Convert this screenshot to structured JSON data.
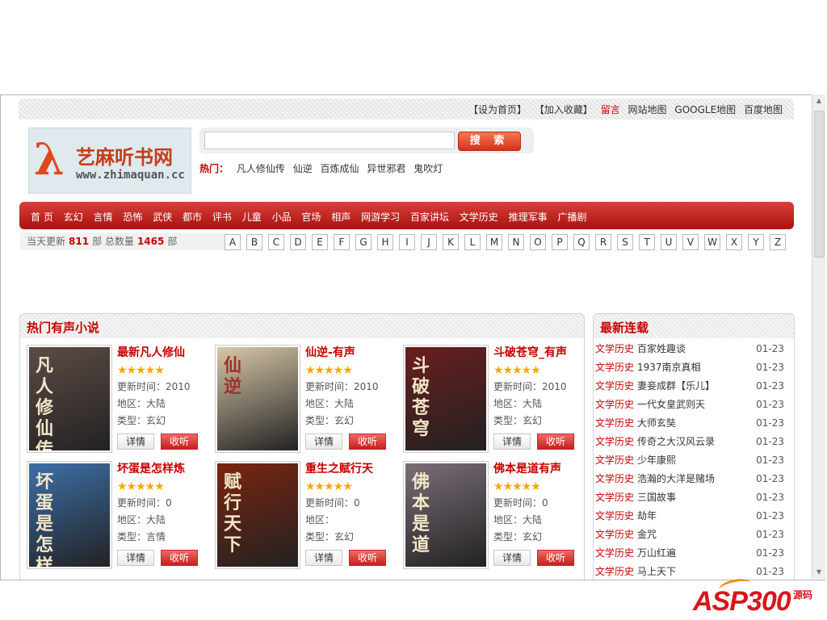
{
  "toplinks": [
    "【设为首页】",
    "【加入收藏】",
    "留言",
    "网站地图",
    "GOOGLE地图",
    "百度地图"
  ],
  "logo": {
    "name": "艺麻听书网",
    "url": "www.zhimaquan.cc"
  },
  "search": {
    "value": "",
    "button": "搜 索"
  },
  "hot": {
    "label": "热门：",
    "keywords": [
      "凡人修仙传",
      "仙逆",
      "百炼成仙",
      "异世邪君",
      "鬼吹灯"
    ]
  },
  "nav": [
    "首 页",
    "玄幻",
    "言情",
    "恐怖",
    "武侠",
    "都市",
    "评书",
    "儿童",
    "小品",
    "官场",
    "相声",
    "网游学习",
    "百家讲坛",
    "文学历史",
    "推理军事",
    "广播剧"
  ],
  "stats": {
    "today_label": "当天更新",
    "today": "811",
    "unit": "部",
    "total_label": "总数量",
    "total": "1465"
  },
  "letters": [
    "A",
    "B",
    "C",
    "D",
    "E",
    "F",
    "G",
    "H",
    "I",
    "J",
    "K",
    "L",
    "M",
    "N",
    "O",
    "P",
    "Q",
    "R",
    "S",
    "T",
    "U",
    "V",
    "W",
    "X",
    "Y",
    "Z"
  ],
  "main": {
    "title": "热门有声小说",
    "books": [
      {
        "title": "最新凡人修仙",
        "stars": "★★★★★",
        "update": "更新时间：2010",
        "region": "地区：大陆",
        "type": "类型：玄幻",
        "cover_text": "凡人修仙传",
        "cover_color": "#5d4b45"
      },
      {
        "title": "仙逆-有声",
        "stars": "★★★★★",
        "update": "更新时间：2010",
        "region": "地区：大陆",
        "type": "类型：玄幻",
        "cover_text": "仙逆",
        "cover_color": "#d8c7a8"
      },
      {
        "title": "斗破苍穹_有声",
        "stars": "★★★★★",
        "update": "更新时间：2010",
        "region": "地区：大陆",
        "type": "类型：玄幻",
        "cover_text": "斗破苍穹",
        "cover_color": "#6a1e1e"
      },
      {
        "title": "坏蛋是怎样炼",
        "stars": "★★★★★",
        "update": "更新时间：0",
        "region": "地区：大陆",
        "type": "类型：言情",
        "cover_text": "坏蛋是怎样炼成",
        "cover_color": "#3d6fa8"
      },
      {
        "title": "重生之赋行天",
        "stars": "★★★★★",
        "update": "更新时间：0",
        "region": "地区：",
        "type": "类型：玄幻",
        "cover_text": "赋行天下",
        "cover_color": "#7a2410"
      },
      {
        "title": "佛本是道有声",
        "stars": "★★★★★",
        "update": "更新时间：0",
        "region": "地区：大陆",
        "type": "类型：玄幻",
        "cover_text": "佛本是道",
        "cover_color": "#7a6e78"
      }
    ],
    "btn_detail": "详情",
    "btn_listen": "收听"
  },
  "side": {
    "title": "最新连载",
    "items": [
      {
        "cat": "文学历史",
        "name": "百家姓趣谈",
        "date": "01-23"
      },
      {
        "cat": "文学历史",
        "name": "1937南京真相",
        "date": "01-23"
      },
      {
        "cat": "文学历史",
        "name": "妻妾成群【乐儿】",
        "date": "01-23"
      },
      {
        "cat": "文学历史",
        "name": "一代女皇武则天",
        "date": "01-23"
      },
      {
        "cat": "文学历史",
        "name": "大师玄奘",
        "date": "01-23"
      },
      {
        "cat": "文学历史",
        "name": "传奇之大汉风云录",
        "date": "01-23"
      },
      {
        "cat": "文学历史",
        "name": "少年康熙",
        "date": "01-23"
      },
      {
        "cat": "文学历史",
        "name": "浩瀚的大洋是赌场",
        "date": "01-23"
      },
      {
        "cat": "文学历史",
        "name": "三国故事",
        "date": "01-23"
      },
      {
        "cat": "文学历史",
        "name": "劫年",
        "date": "01-23"
      },
      {
        "cat": "文学历史",
        "name": "金咒",
        "date": "01-23"
      },
      {
        "cat": "文学历史",
        "name": "万山红遍",
        "date": "01-23"
      },
      {
        "cat": "文学历史",
        "name": "马上天下",
        "date": "01-23"
      }
    ]
  },
  "watermark": {
    "text": "ASP300",
    "sub": "源码"
  }
}
